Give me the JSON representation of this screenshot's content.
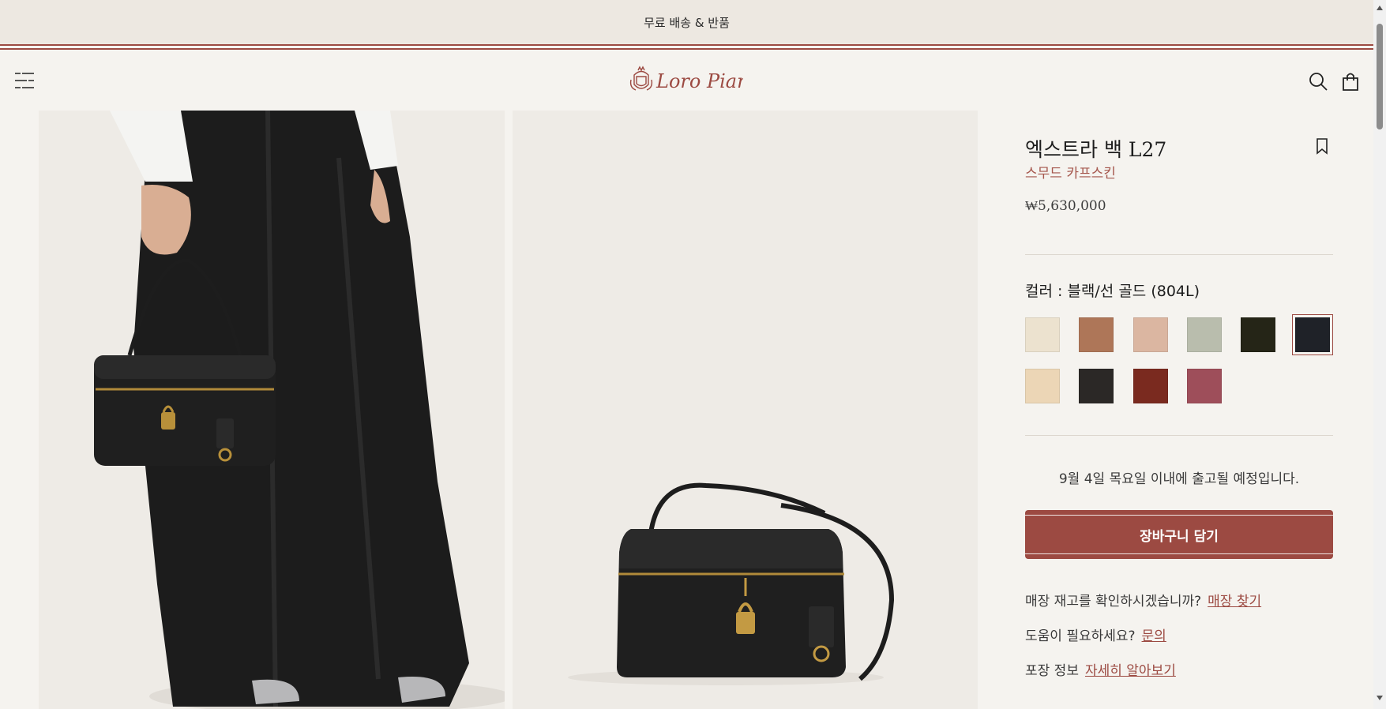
{
  "announcement": {
    "text": "무료 배송 & 반품"
  },
  "header": {
    "logo_text": "Loro Piana",
    "icons": [
      "menu-icon",
      "search-icon",
      "bag-icon"
    ]
  },
  "product": {
    "title": "엑스트라 백 L27",
    "subtitle": "스무드 카프스킨",
    "price": "₩5,630,000",
    "color_label": "컬러 : 블랙/선 골드 (804L)",
    "selected_swatch_index": 5,
    "swatches": [
      {
        "color": "#ece2cf"
      },
      {
        "color": "#ae7658"
      },
      {
        "color": "#dbb6a1"
      },
      {
        "color": "#b9bdad"
      },
      {
        "color": "#252517"
      },
      {
        "color": "#1f2228"
      },
      {
        "color": "#ecd6b6"
      },
      {
        "color": "#2b2826"
      },
      {
        "color": "#7a2a1f"
      },
      {
        "color": "#9e4e5a"
      }
    ],
    "shipping_text": "9월 4일 목요일 이내에 출고될 예정입니다.",
    "add_to_cart": "장바구니 담기",
    "stock": {
      "question": "매장 재고를 확인하시겠습니까?",
      "link": "매장 찾기"
    },
    "help": {
      "question": "도움이 필요하세요?",
      "link": "문의"
    },
    "packaging": {
      "label": "포장 정보",
      "link": "자세히 알아보기"
    }
  },
  "colors": {
    "accent": "#9c4a42",
    "background": "#f5f3ef",
    "announcement_bg": "#ede8e1"
  }
}
